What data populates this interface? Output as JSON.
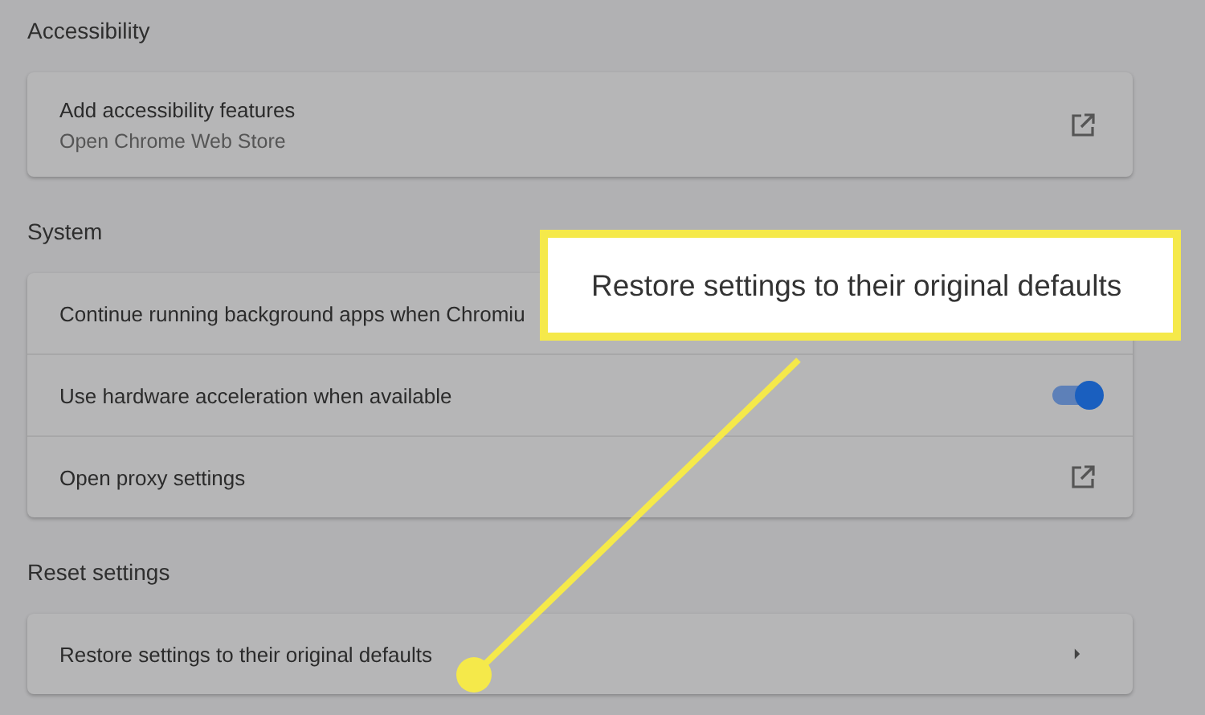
{
  "sections": [
    {
      "title": "Accessibility",
      "rows": [
        {
          "kind": "link",
          "label": "Add accessibility features",
          "sublabel": "Open Chrome Web Store"
        }
      ]
    },
    {
      "title": "System",
      "rows": [
        {
          "kind": "plain",
          "label": "Continue running background apps when Chromiu"
        },
        {
          "kind": "toggle",
          "label": "Use hardware acceleration when available",
          "on": true
        },
        {
          "kind": "link",
          "label": "Open proxy settings"
        }
      ]
    },
    {
      "title": "Reset settings",
      "rows": [
        {
          "kind": "arrow",
          "label": "Restore settings to their original defaults"
        }
      ]
    }
  ],
  "callout": {
    "text": "Restore settings to their original defaults"
  }
}
